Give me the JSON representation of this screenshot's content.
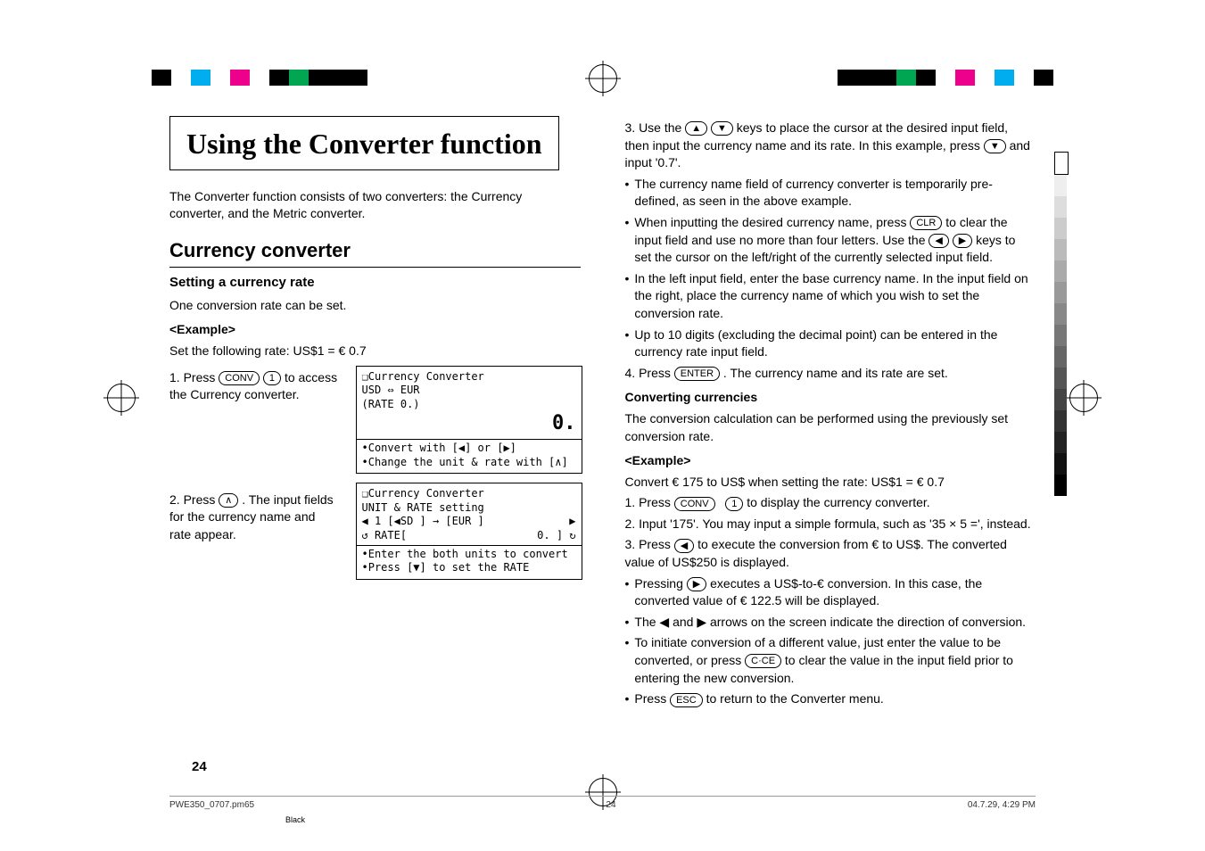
{
  "title": "Using the Converter function",
  "intro": "The Converter function consists of two converters: the Currency converter, and the Metric converter.",
  "h2_currency": "Currency converter",
  "h3_setting": "Setting a currency rate",
  "setting_line": "One conversion rate can be set.",
  "example_label": "<Example>",
  "set_rate_line": "Set the following rate: US$1 = € 0.7",
  "step1_press": "1.  Press ",
  "key_conv": "CONV",
  "key_1": "1",
  "step1_tail": " to access the Currency converter.",
  "step2_press": "2.  Press ",
  "key_up_caret": "∧",
  "step2_tail": ". The input fields for the currency name and rate appear.",
  "lcd1": {
    "t1": "❑Currency Converter",
    "t2": "USD ⇔ EUR",
    "t3": "(RATE 0.)",
    "big": "0.",
    "t4": "•Convert with [◀] or [▶]",
    "t5": "•Change the unit & rate with [∧]"
  },
  "lcd2": {
    "t1": "❑Currency Converter",
    "t2": " UNIT & RATE setting",
    "t3l": "◀ 1 [◀SD ] → [EUR ]",
    "rowL": "↺  RATE[",
    "rowR": "0. ]    ↻",
    "t5": "•Enter the both units to convert",
    "t6": "•Press [▼] to set the RATE"
  },
  "right": {
    "step3_a": "3. Use the ",
    "key_up": "▲",
    "key_down": "▼",
    "step3_b": " keys to place the cursor at the desired input field, then input the currency name and its rate. In this example, press ",
    "step3_c": " and input '0.7'.",
    "b1": "The currency name field of currency converter is temporarily pre-defined, as seen in the above example.",
    "b2a": "When inputting the desired currency name, press ",
    "key_clr": "CLR",
    "b2b": " to clear the input field and use no more than four letters. Use the ",
    "key_left": "◀",
    "key_right": "▶",
    "b2c": " keys to set the cursor on the left/right of the currently selected input field.",
    "b3": "In the left input field, enter the base currency name. In the input field on the right, place the currency name of which you wish to set the conversion rate.",
    "b4": "Up to 10 digits (excluding the decimal point) can be entered in the currency rate input field.",
    "step4a": "4. Press ",
    "key_enter": "ENTER",
    "step4b": ". The currency name and its rate are set.",
    "h4_conv": "Converting currencies",
    "conv_intro": "The conversion calculation can be performed using the previously set conversion rate.",
    "ex2": "Convert € 175 to US$ when setting the rate: US$1 = € 0.7",
    "c1a": "1. Press ",
    "c1b": " to display the currency converter.",
    "c2": "2. Input '175'. You may input a simple formula, such as '35 × 5 =', instead.",
    "c3a": "3. Press ",
    "c3b": " to execute the conversion from € to US$. The converted value of US$250 is displayed.",
    "cb1a": "Pressing ",
    "cb1b": " executes a US$-to-€ conversion. In this case, the converted value of € 122.5 will be displayed.",
    "cb2": "The ◀ and ▶ arrows on the screen indicate the direction of conversion.",
    "cb3a": "To initiate conversion of a different value, just enter the value to be converted, or press ",
    "key_cce": "C·CE",
    "cb3b": " to clear the value in the input field prior to entering the new conversion.",
    "cb4a": "Press ",
    "key_esc": "ESC",
    "cb4b": " to return to the Converter menu."
  },
  "page_number": "24",
  "footer": {
    "file": "PWE350_0707.pm65",
    "pg": "24",
    "date": "04.7.29, 4:29 PM",
    "black": "Black"
  }
}
